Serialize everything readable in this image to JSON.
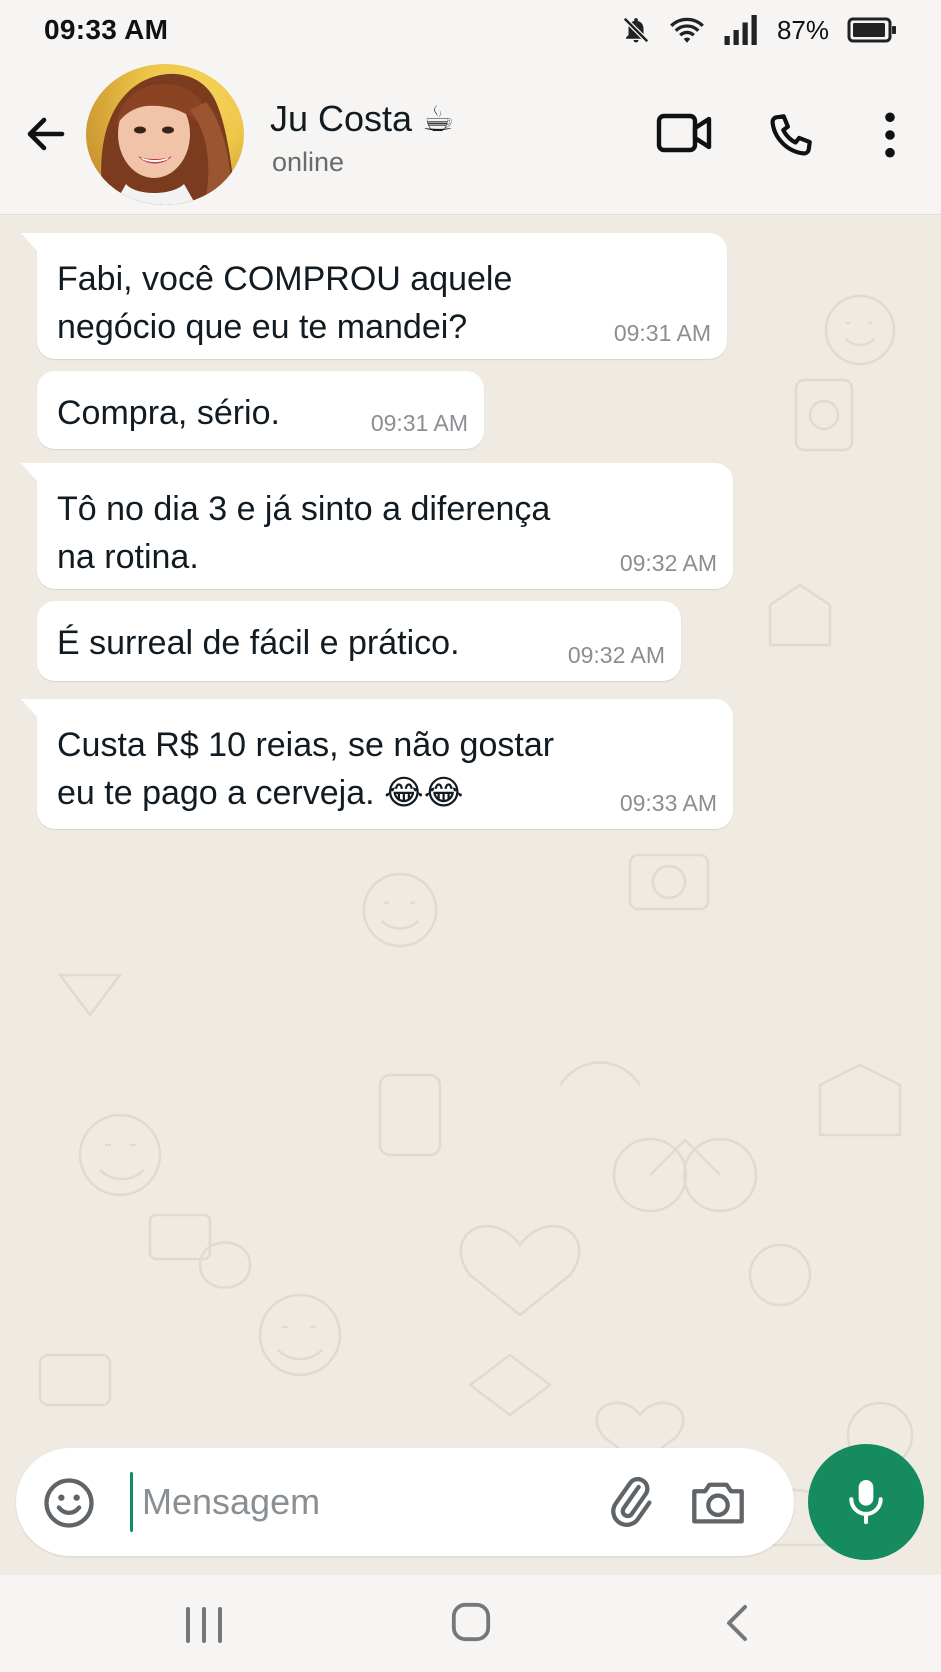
{
  "status_bar": {
    "time": "09:33 AM",
    "battery": "87%"
  },
  "header": {
    "contact_name": "Ju Costa ☕",
    "contact_status": "online"
  },
  "messages": [
    {
      "text": "Fabi, você COMPROU aquele\nnegócio que eu te mandei?",
      "time": "09:31 AM"
    },
    {
      "text": "Compra, sério.",
      "time": "09:31 AM"
    },
    {
      "text": "Tô no dia 3 e já sinto a diferença\nna rotina.",
      "time": "09:32 AM"
    },
    {
      "text": "É surreal de fácil e prático.",
      "time": "09:32 AM"
    },
    {
      "text": "Custa R$ 10 reias, se não gostar\neu te pago a cerveja. 😂😂",
      "time": "09:33 AM"
    }
  ],
  "composer": {
    "placeholder": "Mensagem"
  },
  "icons": {
    "back": "arrow-left-icon",
    "video_call": "video-camera-icon",
    "voice_call": "phone-icon",
    "menu": "more-vertical-icon",
    "emoji": "emoji-icon",
    "attach": "paperclip-icon",
    "camera": "camera-icon",
    "mic": "microphone-icon"
  },
  "colors": {
    "accent": "#168b5f",
    "chat_background": "#efeae2",
    "bubble_incoming": "#ffffff"
  }
}
